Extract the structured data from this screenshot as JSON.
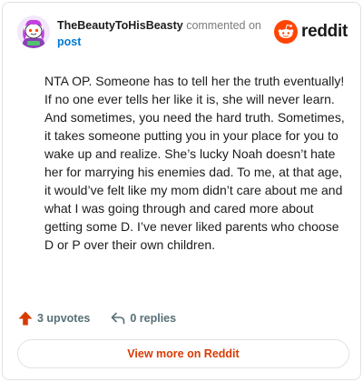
{
  "header": {
    "username": "TheBeautyToHisBeasty",
    "commented_text": "commented on",
    "post_link": "post",
    "brand": "reddit"
  },
  "comment": {
    "text": "NTA OP. Someone has to tell her the truth eventually! If no one ever tells her like it is, she will never learn. And sometimes, you need the hard truth. Sometimes, it takes someone putting you in your place for you to wake up and realize. She’s lucky Noah doesn’t hate her for marrying his enemies dad. To me, at that age, it would’ve felt like my mom didn’t care about me and what I was going through and cared more about getting some D. I’ve never liked parents who choose D or P over their own children."
  },
  "actions": {
    "upvotes": "3 upvotes",
    "replies": "0 replies"
  },
  "footer": {
    "view_more": "View more on Reddit"
  },
  "icons": {
    "avatar": "snoo-avatar-icon",
    "brand": "reddit-logo-icon",
    "upvote": "upvote-arrow-icon",
    "reply": "reply-arrow-icon"
  },
  "colors": {
    "brand_orange": "#ff4500",
    "upvote_orange": "#d93a00",
    "link_blue": "#0079d3",
    "muted_gray": "#576f76"
  }
}
